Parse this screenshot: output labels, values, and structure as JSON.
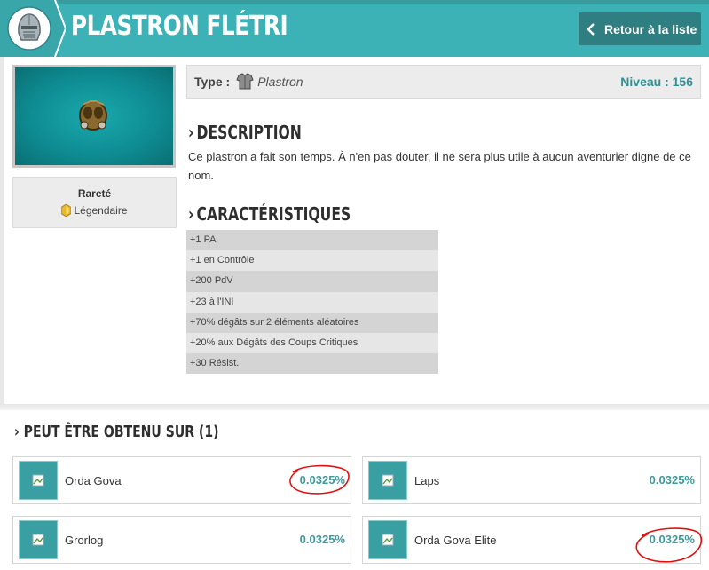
{
  "header": {
    "title": "PLASTRON FLÉTRI",
    "back_label": "Retour à la liste",
    "helmet_icon": "helmet-icon",
    "color": "#3db2b6"
  },
  "item": {
    "type_label": "Type :",
    "type_value": "Plastron",
    "level_label": "Niveau : 156",
    "rarity_title": "Rareté",
    "rarity_value": "Légendaire",
    "rarity_color": "#e8b828"
  },
  "description": {
    "heading": "DESCRIPTION",
    "text": "Ce plastron a fait son temps. À n'en pas douter, il ne sera plus utile à aucun aventurier digne de ce nom."
  },
  "characteristics": {
    "heading": "CARACTÉRISTIQUES",
    "stats": [
      "+1 PA",
      "+1 en Contrôle",
      "+200 PdV",
      "+23 à l'INI",
      "+70% dégâts sur 2 éléments aléatoires",
      "+20% aux Dégâts des Coups Critiques",
      "+30 Résist."
    ]
  },
  "obtain": {
    "heading": "PEUT ÊTRE OBTENU SUR (1)",
    "drops": [
      {
        "name": "Orda Gova",
        "rate": "0.0325%",
        "circled": true
      },
      {
        "name": "Laps",
        "rate": "0.0325%",
        "circled": false
      },
      {
        "name": "Grorlog",
        "rate": "0.0325%",
        "circled": false
      },
      {
        "name": "Orda Gova Elite",
        "rate": "0.0325%",
        "circled": true
      }
    ]
  }
}
